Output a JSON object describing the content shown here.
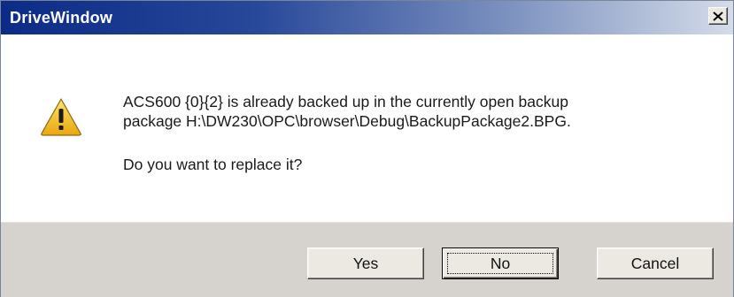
{
  "window": {
    "title": "DriveWindow",
    "close_label": "×"
  },
  "message": {
    "line1": "ACS600 {0}{2} is already backed up in the currently open backup",
    "line2": "package H:\\DW230\\OPC\\browser\\Debug\\BackupPackage2.BPG.",
    "question": "Do you want to replace it?"
  },
  "icon": {
    "name": "warning-icon",
    "color": "#f2c12e"
  },
  "buttons": {
    "yes": "Yes",
    "no": "No",
    "cancel": "Cancel"
  }
}
